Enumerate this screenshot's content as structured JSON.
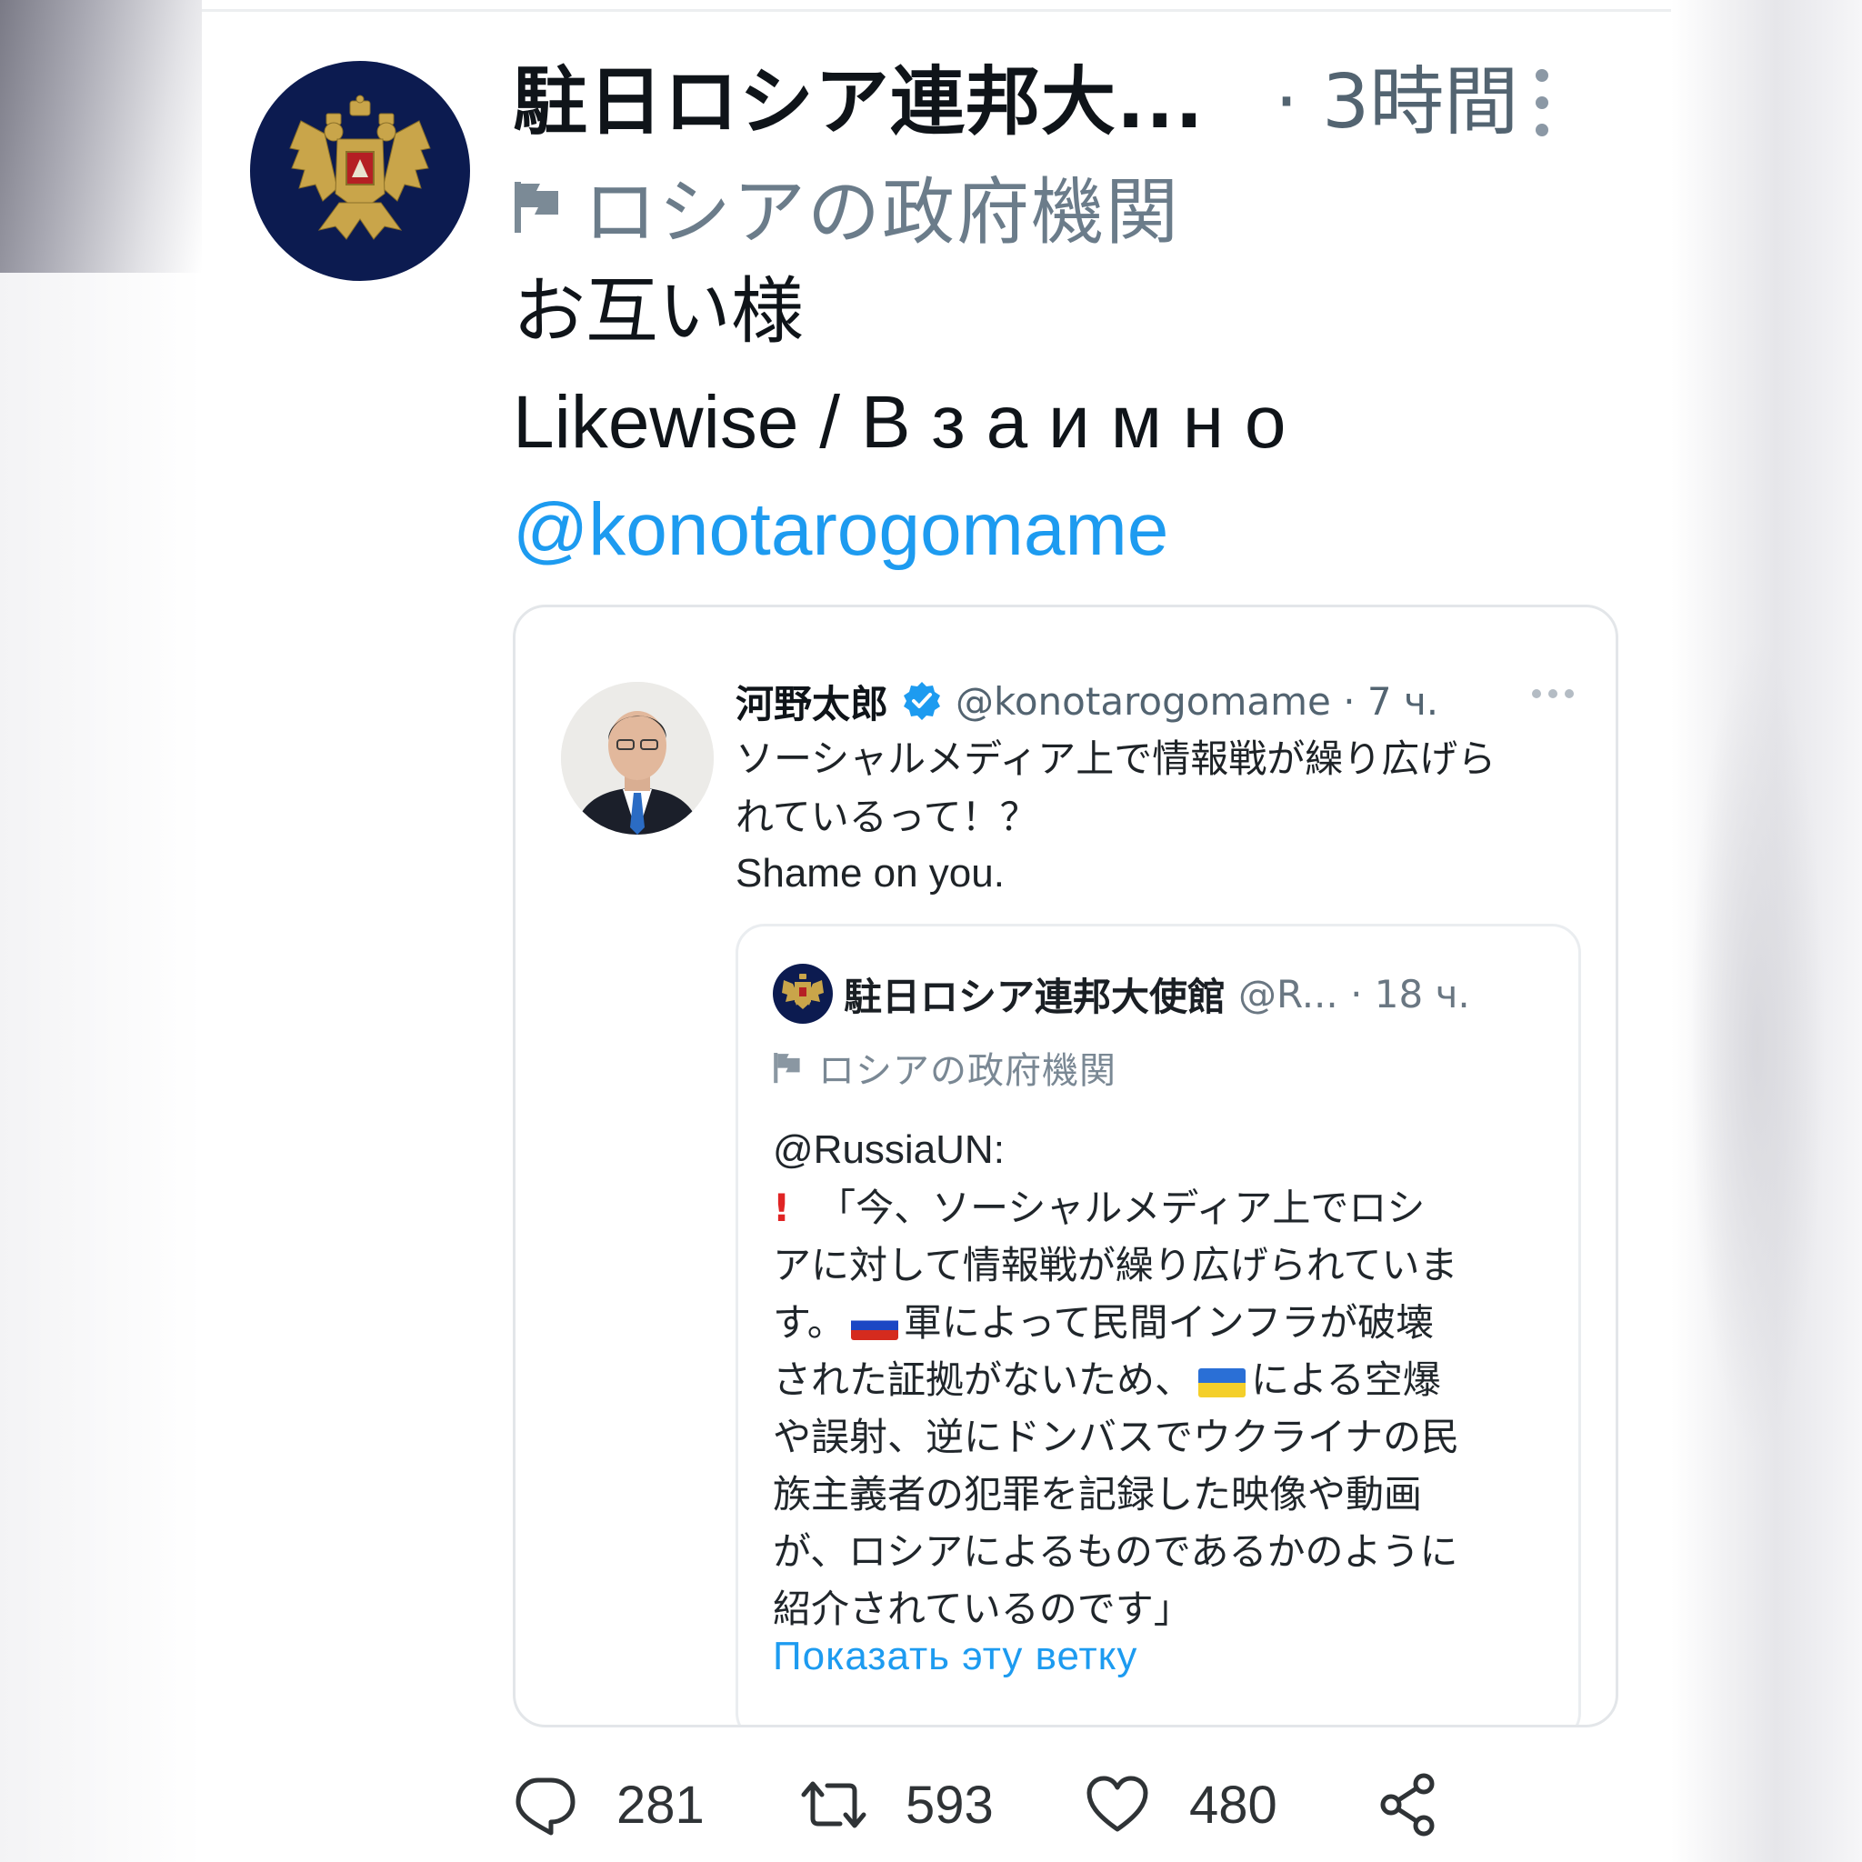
{
  "main_tweet": {
    "author_name": "駐日ロシア連邦大...",
    "time": "· 3時間",
    "gov_label": "ロシアの政府機関",
    "text_lines": [
      "お互い様",
      "Likewise / В з а и м н о",
      "@konotarogomame"
    ]
  },
  "quote": {
    "author_name": "河野太郎",
    "handle_time": "@konotarogomame · 7 ч.",
    "text_lines": [
      "ソーシャルメディア上で情報戦が繰り広げら",
      "れているって！？",
      "Shame on you."
    ]
  },
  "inner_quote": {
    "author_name": "駐日ロシア連邦大使館",
    "handle_time": "@R... · 18 ч.",
    "gov_label": "ロシアの政府機関",
    "mention": "@RussiaUN:",
    "line1": "「今、ソーシャルメディア上でロシ",
    "line2": "アに対して情報戦が繰り広げられていま",
    "line3_a": "す。",
    "line3_b": "軍によって民間インフラが破壊",
    "line4_a": "された証拠がないため、",
    "line4_b": "による空爆",
    "line5": "や誤射、逆にドンバスでウクライナの民",
    "line6": "族主義者の犯罪を記録した映像や動画",
    "line7": "が、ロシアによるものであるかのように",
    "line8": "紹介されているのです」",
    "show_thread": "Показать эту ветку"
  },
  "actions": {
    "replies": "281",
    "retweets": "593",
    "likes": "480"
  },
  "icons": {
    "flag": "flag-icon",
    "verified": "verified-badge-icon",
    "more": "more-icon",
    "reply": "reply-icon",
    "retweet": "retweet-icon",
    "like": "heart-icon",
    "share": "share-icon"
  },
  "colors": {
    "link": "#1d9bf0",
    "secondary": "#536471",
    "emblem_bg": "#0c1b50",
    "emblem_gold": "#c9a54a"
  }
}
